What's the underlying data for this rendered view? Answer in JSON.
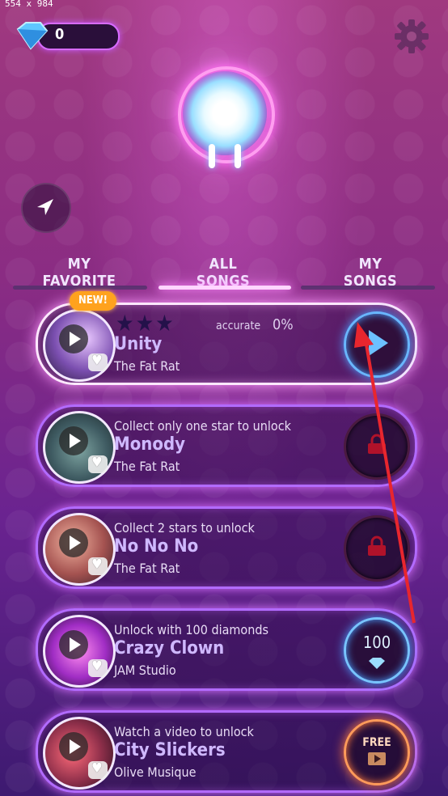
{
  "screen_label": "554 x 984",
  "diamonds": "0",
  "tabs": [
    {
      "label": "MY FAVORITE"
    },
    {
      "label": "ALL SONGS"
    },
    {
      "label": "MY SONGS"
    }
  ],
  "unity": {
    "badge": "NEW!",
    "title": "Unity",
    "artist": "The Fat Rat",
    "accuracy_label": "accurate",
    "accuracy_value": "0%",
    "stars_filled": 0,
    "stars_total": 3
  },
  "songs": [
    {
      "status": "Collect only one star to unlock",
      "title": "Monody",
      "artist": "The Fat Rat"
    },
    {
      "status": "Collect 2 stars to unlock",
      "title": "No No No",
      "artist": "The Fat Rat"
    },
    {
      "status": "Unlock with 100 diamonds",
      "title": "Crazy Clown",
      "artist": "JAM Studio",
      "price": "100"
    },
    {
      "status": "Watch a video to unlock",
      "title": "City Slickers",
      "artist": "Olive Musique",
      "free_label": "FREE"
    }
  ],
  "colors": {
    "accent": "#b26bff",
    "play": "#69b6ff",
    "free": "#ff9a5a",
    "badge": "#ffa21e"
  }
}
